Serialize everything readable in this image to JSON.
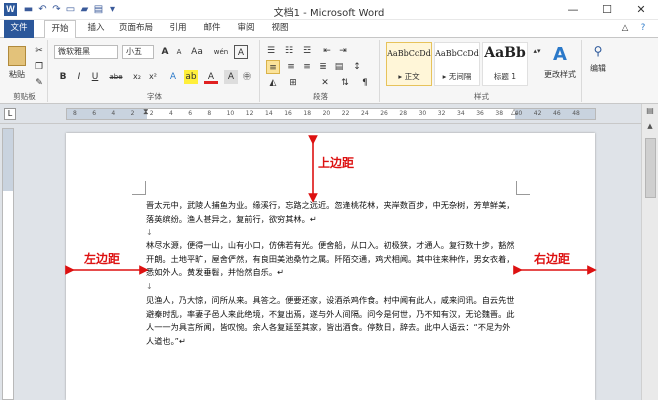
{
  "window": {
    "app_icon": "W",
    "title": "文档1 - Microsoft Word",
    "minimize": "—",
    "maximize": "☐",
    "close": "✕"
  },
  "quick_access": [
    "save-icon",
    "undo-icon",
    "redo-icon",
    "new-icon",
    "open-icon",
    "print-icon"
  ],
  "tabs": [
    "文件",
    "开始",
    "插入",
    "页面布局",
    "引用",
    "邮件",
    "审阅",
    "视图"
  ],
  "ribbon": {
    "clipboard": {
      "paste": "粘贴",
      "label": "剪贴板"
    },
    "font": {
      "font_name": "微软雅黑",
      "font_size": "小五",
      "grow": "A",
      "shrink": "A",
      "case": "Aa",
      "phonetic": "wén",
      "char_border": "A",
      "bold": "B",
      "italic": "I",
      "underline": "U",
      "strike": "abe",
      "sub": "x₂",
      "sup": "x²",
      "label": "字体"
    },
    "paragraph": {
      "label": "段落"
    },
    "styles": {
      "items": [
        {
          "sample": "AaBbCcDd",
          "name": "▸ 正文"
        },
        {
          "sample": "AaBbCcDd",
          "name": "▸ 无间隔"
        },
        {
          "sample": "AaBb",
          "name": "标题 1"
        }
      ],
      "change_styles": "更改样式",
      "label": "样式"
    },
    "editing": {
      "label": "编辑"
    }
  },
  "ruler_marks": [
    "8",
    "6",
    "4",
    "2",
    "2",
    "4",
    "6",
    "8",
    "10",
    "12",
    "14",
    "16",
    "18",
    "20",
    "22",
    "24",
    "26",
    "28",
    "30",
    "32",
    "34",
    "36",
    "38",
    "40",
    "42",
    "46",
    "48"
  ],
  "document": {
    "paragraphs": [
      "晋太元中，武陵人捕鱼为业。缘溪行，忘路之远近。忽逢桃花林，夹岸数百步，中无杂树，芳草鲜美，落英缤纷。渔人甚异之，复前行，欲穷其林。↵",
      "林尽水源，便得一山，山有小口，仿佛若有光。便舍船，从口入。初极狭，才通人。复行数十步，豁然开朗。土地平旷，屋舍俨然，有良田美池桑竹之属。阡陌交通，鸡犬相闻。其中往来种作，男女衣着，悉如外人。黄发垂髫，并怡然自乐。↵",
      "见渔人，乃大惊，问所从来。具答之。便要还家，设酒杀鸡作食。村中闻有此人，咸来问讯。自云先世避秦时乱，率妻子邑人来此绝境，不复出焉，遂与外人间隔。问今是何世，乃不知有汉，无论魏晋。此人一一为具言所闻，皆叹惋。余人各复延至其家，皆出酒食。停数日，辞去。此中人语云：“不足为外人道也。”↵"
    ],
    "para_mark": "↓"
  },
  "annotations": {
    "top_margin": "上边距",
    "left_margin": "左边距",
    "right_margin": "右边距"
  },
  "accent_colors": {
    "word_blue": "#2b579a",
    "annotation_red": "#dd1111"
  }
}
